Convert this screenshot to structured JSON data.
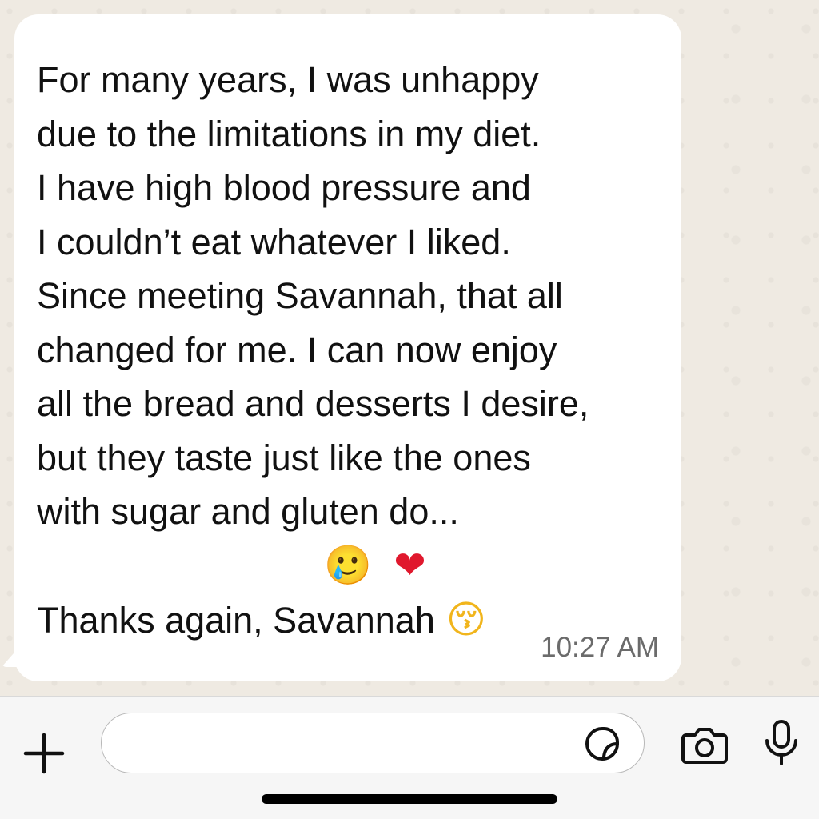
{
  "message": {
    "lines": [
      "For many years, I was unhappy",
      "due to the limitations in my diet.",
      "I have high blood pressure and",
      "I couldn’t eat whatever I liked.",
      "Since meeting Savannah, that all",
      "changed for me. I can now enjoy",
      "all the bread and desserts I desire,",
      "but they taste just like the ones",
      "with sugar and gluten do..."
    ],
    "emoji_crying": "🥲",
    "emoji_heart": "❤",
    "thanks_text": "Thanks again, Savannah",
    "thanks_emoji": "😚",
    "timestamp": "10:27 AM"
  },
  "composer": {
    "input_value": "",
    "icons": {
      "attach": "plus-icon",
      "sticker": "sticker-icon",
      "camera": "camera-icon",
      "microphone": "mic-icon"
    }
  },
  "colors": {
    "wallpaper": "#efeae2",
    "bubble": "#ffffff",
    "input_bar": "#f6f6f6",
    "timestamp": "#6b6b6b"
  }
}
